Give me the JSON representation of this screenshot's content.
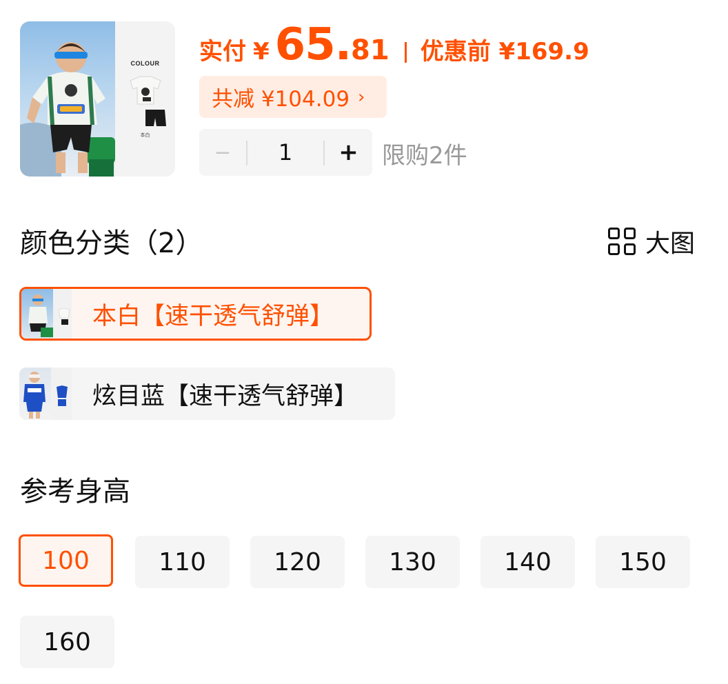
{
  "product": {
    "image_icon": "kids-tshirt-shorts-product-photo",
    "image_colour_text": "COLOUR",
    "image_variant_text": "本白"
  },
  "price": {
    "pay_label": "实付",
    "currency": "¥",
    "amount_int": "65.",
    "amount_dec": "81",
    "original_label": "优惠前 ¥169.9",
    "saving_label": "共减 ¥104.09",
    "saving_chevron": "›",
    "accent_color": "#ff5000"
  },
  "quantity": {
    "minus": "−",
    "value": "1",
    "plus": "+",
    "limit": "限购2件"
  },
  "color_section": {
    "title": "颜色分类（2）",
    "big_view_label": "大图",
    "big_view_icon": "grid-icon",
    "options": [
      {
        "label": "本白【速干透气舒弹】",
        "selected": true,
        "thumb_icon": "white-outfit-thumbnail"
      },
      {
        "label": "炫目蓝【速干透气舒弹】",
        "selected": false,
        "thumb_icon": "blue-outfit-thumbnail"
      }
    ]
  },
  "height_section": {
    "title": "参考身高",
    "sizes": [
      "100",
      "110",
      "120",
      "130",
      "140",
      "150",
      "160"
    ],
    "selected": "100"
  }
}
